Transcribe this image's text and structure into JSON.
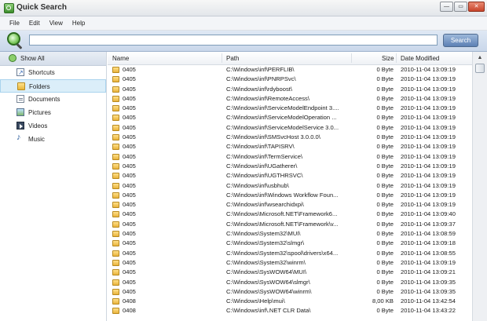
{
  "window": {
    "title": "Quick Search",
    "min": "—",
    "max": "▭",
    "close": "✕"
  },
  "menu": [
    "File",
    "Edit",
    "View",
    "Help"
  ],
  "search": {
    "value": "",
    "placeholder": "",
    "button": "Search"
  },
  "sidebar": [
    {
      "label": "Show All",
      "icon": "search-icon",
      "kind": "all"
    },
    {
      "label": "Shortcuts",
      "icon": "shortcut-icon",
      "kind": "normal"
    },
    {
      "label": "Folders",
      "icon": "folder-icon",
      "kind": "selected"
    },
    {
      "label": "Documents",
      "icon": "document-icon",
      "kind": "normal"
    },
    {
      "label": "Pictures",
      "icon": "picture-icon",
      "kind": "normal"
    },
    {
      "label": "Videos",
      "icon": "video-icon",
      "kind": "normal"
    },
    {
      "label": "Music",
      "icon": "music-icon",
      "kind": "normal"
    }
  ],
  "columns": {
    "name": "Name",
    "path": "Path",
    "size": "Size",
    "date": "Date Modified"
  },
  "rows": [
    {
      "name": "0405",
      "path": "C:\\Windows\\inf\\PERFLIB\\",
      "size": "0 Byte",
      "date": "2010-11-04 13:09:19"
    },
    {
      "name": "0405",
      "path": "C:\\Windows\\inf\\PNRPSvc\\",
      "size": "0 Byte",
      "date": "2010-11-04 13:09:19"
    },
    {
      "name": "0405",
      "path": "C:\\Windows\\inf\\rdyboost\\",
      "size": "0 Byte",
      "date": "2010-11-04 13:09:19"
    },
    {
      "name": "0405",
      "path": "C:\\Windows\\inf\\RemoteAccess\\",
      "size": "0 Byte",
      "date": "2010-11-04 13:09:19"
    },
    {
      "name": "0405",
      "path": "C:\\Windows\\inf\\ServiceModelEndpoint 3....",
      "size": "0 Byte",
      "date": "2010-11-04 13:09:19"
    },
    {
      "name": "0405",
      "path": "C:\\Windows\\inf\\ServiceModelOperation ...",
      "size": "0 Byte",
      "date": "2010-11-04 13:09:19"
    },
    {
      "name": "0405",
      "path": "C:\\Windows\\inf\\ServiceModelService 3.0...",
      "size": "0 Byte",
      "date": "2010-11-04 13:09:19"
    },
    {
      "name": "0405",
      "path": "C:\\Windows\\inf\\SMSvcHost 3.0.0.0\\",
      "size": "0 Byte",
      "date": "2010-11-04 13:09:19"
    },
    {
      "name": "0405",
      "path": "C:\\Windows\\inf\\TAPISRV\\",
      "size": "0 Byte",
      "date": "2010-11-04 13:09:19"
    },
    {
      "name": "0405",
      "path": "C:\\Windows\\inf\\TermService\\",
      "size": "0 Byte",
      "date": "2010-11-04 13:09:19"
    },
    {
      "name": "0405",
      "path": "C:\\Windows\\inf\\UGatherer\\",
      "size": "0 Byte",
      "date": "2010-11-04 13:09:19"
    },
    {
      "name": "0405",
      "path": "C:\\Windows\\inf\\UGTHRSVC\\",
      "size": "0 Byte",
      "date": "2010-11-04 13:09:19"
    },
    {
      "name": "0405",
      "path": "C:\\Windows\\inf\\usbhub\\",
      "size": "0 Byte",
      "date": "2010-11-04 13:09:19"
    },
    {
      "name": "0405",
      "path": "C:\\Windows\\inf\\Windows Workflow Foun...",
      "size": "0 Byte",
      "date": "2010-11-04 13:09:19"
    },
    {
      "name": "0405",
      "path": "C:\\Windows\\inf\\wsearchidxpi\\",
      "size": "0 Byte",
      "date": "2010-11-04 13:09:19"
    },
    {
      "name": "0405",
      "path": "C:\\Windows\\Microsoft.NET\\Framework6...",
      "size": "0 Byte",
      "date": "2010-11-04 13:09:40"
    },
    {
      "name": "0405",
      "path": "C:\\Windows\\Microsoft.NET\\Framework\\v...",
      "size": "0 Byte",
      "date": "2010-11-04 13:09:37"
    },
    {
      "name": "0405",
      "path": "C:\\Windows\\System32\\MUI\\",
      "size": "0 Byte",
      "date": "2010-11-04 13:08:59"
    },
    {
      "name": "0405",
      "path": "C:\\Windows\\System32\\slmgr\\",
      "size": "0 Byte",
      "date": "2010-11-04 13:09:18"
    },
    {
      "name": "0405",
      "path": "C:\\Windows\\System32\\spool\\drivers\\x64...",
      "size": "0 Byte",
      "date": "2010-11-04 13:08:55"
    },
    {
      "name": "0405",
      "path": "C:\\Windows\\System32\\winrm\\",
      "size": "0 Byte",
      "date": "2010-11-04 13:09:19"
    },
    {
      "name": "0405",
      "path": "C:\\Windows\\SysWOW64\\MUI\\",
      "size": "0 Byte",
      "date": "2010-11-04 13:09:21"
    },
    {
      "name": "0405",
      "path": "C:\\Windows\\SysWOW64\\slmgr\\",
      "size": "0 Byte",
      "date": "2010-11-04 13:09:35"
    },
    {
      "name": "0405",
      "path": "C:\\Windows\\SysWOW64\\winrm\\",
      "size": "0 Byte",
      "date": "2010-11-04 13:09:35"
    },
    {
      "name": "0408",
      "path": "C:\\Windows\\Help\\mui\\",
      "size": "8,00 KB",
      "date": "2010-11-04 13:42:54"
    },
    {
      "name": "0408",
      "path": "C:\\Windows\\inf\\.NET CLR Data\\",
      "size": "0 Byte",
      "date": "2010-11-04 13:43:22"
    }
  ]
}
